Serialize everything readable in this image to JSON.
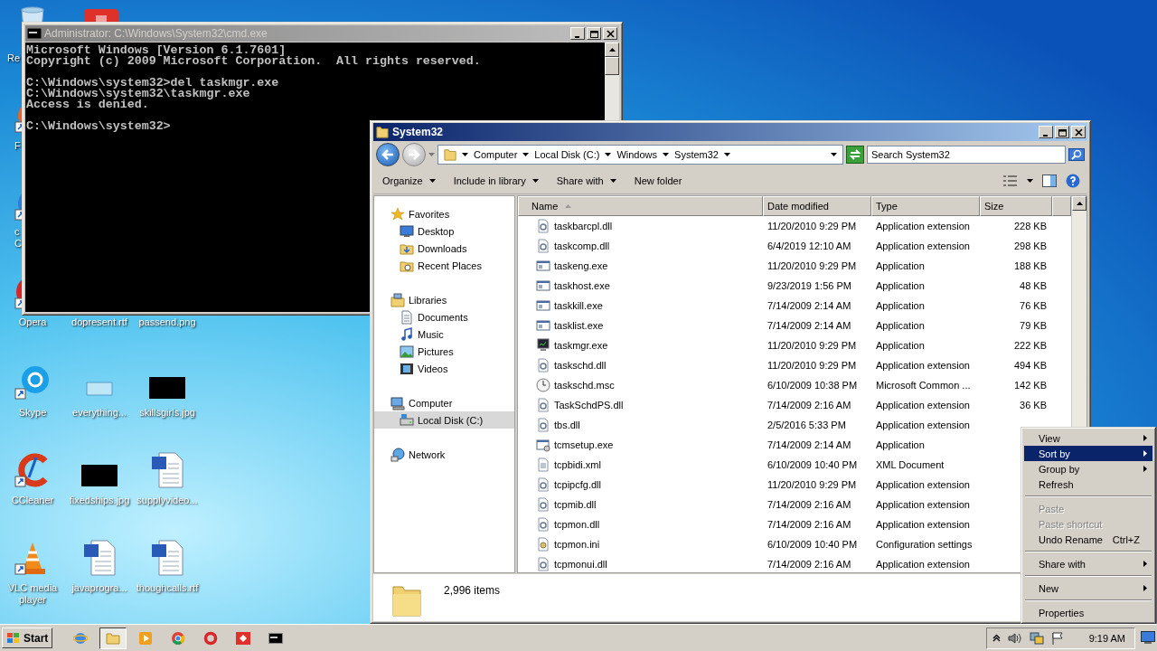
{
  "desktop": {
    "icons": [
      {
        "kind": "recycle",
        "label": "Re"
      },
      {
        "kind": "red-app"
      },
      {
        "kind": "partial-orange",
        "label": "F"
      },
      {
        "kind": "partial-blue",
        "label": "c C"
      },
      {
        "kind": "opera",
        "label": "Opera"
      },
      {
        "kind": "covered",
        "label": "dopresent.rtf"
      },
      {
        "kind": "covered",
        "label": "passend.png"
      },
      {
        "kind": "skype",
        "label": "Skype"
      },
      {
        "kind": "blank",
        "label": "everything..."
      },
      {
        "kind": "black-image",
        "label": "skillsgirls.jpg"
      },
      {
        "kind": "ccleaner",
        "label": "CCleaner"
      },
      {
        "kind": "black-image",
        "label": "fixedships.jpg"
      },
      {
        "kind": "word",
        "label": "supplyvideo..."
      },
      {
        "kind": "vlc",
        "label": "VLC media player"
      },
      {
        "kind": "word",
        "label": "javaprogra..."
      },
      {
        "kind": "word",
        "label": "thoughcalls.rtf"
      }
    ]
  },
  "cmd_window": {
    "title": "Administrator: C:\\Windows\\System32\\cmd.exe",
    "blocks": [
      [
        "Microsoft Windows [Version 6.1.7601]",
        "Copyright (c) 2009 Microsoft Corporation.  All rights reserved."
      ],
      [
        "C:\\Windows\\system32>del taskmgr.exe",
        "C:\\Windows\\system32\\taskmgr.exe",
        "Access is denied."
      ],
      [
        "C:\\Windows\\system32>"
      ]
    ]
  },
  "explorer": {
    "title": "System32",
    "breadcrumb": [
      "Computer",
      "Local Disk (C:)",
      "Windows",
      "System32"
    ],
    "search": {
      "placeholder": "Search System32"
    },
    "toolbar": [
      {
        "label": "Organize",
        "dropdown": true
      },
      {
        "label": "Include in library",
        "dropdown": true
      },
      {
        "label": "Share with",
        "dropdown": true
      },
      {
        "label": "New folder",
        "dropdown": false
      }
    ],
    "nav": [
      {
        "label": "Favorites",
        "kind": "star",
        "selected": false,
        "children": [
          {
            "label": "Desktop",
            "kind": "desktop",
            "selected": false
          },
          {
            "label": "Downloads",
            "kind": "downloads",
            "selected": false
          },
          {
            "label": "Recent Places",
            "kind": "recent",
            "selected": false
          }
        ]
      },
      {
        "label": "Libraries",
        "kind": "library",
        "selected": false,
        "children": [
          {
            "label": "Documents",
            "kind": "documents",
            "selected": false
          },
          {
            "label": "Music",
            "kind": "music",
            "selected": false
          },
          {
            "label": "Pictures",
            "kind": "pictures",
            "selected": false
          },
          {
            "label": "Videos",
            "kind": "videos",
            "selected": false
          }
        ]
      },
      {
        "label": "Computer",
        "kind": "computer",
        "selected": false,
        "children": [
          {
            "label": "Local Disk (C:)",
            "kind": "drive",
            "selected": true
          }
        ]
      },
      {
        "label": "Network",
        "kind": "network",
        "selected": false
      }
    ],
    "columns": [
      {
        "label": "Name",
        "sorted": true
      },
      {
        "label": "Date modified",
        "sorted": false
      },
      {
        "label": "Type",
        "sorted": false
      },
      {
        "label": "Size",
        "sorted": false
      }
    ],
    "rows": [
      {
        "name": "taskbarcpl.dll",
        "date": "11/20/2010 9:29 PM",
        "type": "Application extension",
        "size": "228 KB",
        "kind": "dll"
      },
      {
        "name": "taskcomp.dll",
        "date": "6/4/2019 12:10 AM",
        "type": "Application extension",
        "size": "298 KB",
        "kind": "dll"
      },
      {
        "name": "taskeng.exe",
        "date": "11/20/2010 9:29 PM",
        "type": "Application",
        "size": "188 KB",
        "kind": "exe"
      },
      {
        "name": "taskhost.exe",
        "date": "9/23/2019 1:56 PM",
        "type": "Application",
        "size": "48 KB",
        "kind": "exe"
      },
      {
        "name": "taskkill.exe",
        "date": "7/14/2009 2:14 AM",
        "type": "Application",
        "size": "76 KB",
        "kind": "exe"
      },
      {
        "name": "tasklist.exe",
        "date": "7/14/2009 2:14 AM",
        "type": "Application",
        "size": "79 KB",
        "kind": "exe"
      },
      {
        "name": "taskmgr.exe",
        "date": "11/20/2010 9:29 PM",
        "type": "Application",
        "size": "222 KB",
        "kind": "monitor"
      },
      {
        "name": "taskschd.dll",
        "date": "11/20/2010 9:29 PM",
        "type": "Application extension",
        "size": "494 KB",
        "kind": "dll"
      },
      {
        "name": "taskschd.msc",
        "date": "6/10/2009 10:38 PM",
        "type": "Microsoft Common ...",
        "size": "142 KB",
        "kind": "clock"
      },
      {
        "name": "TaskSchdPS.dll",
        "date": "7/14/2009 2:16 AM",
        "type": "Application extension",
        "size": "36 KB",
        "kind": "dll"
      },
      {
        "name": "tbs.dll",
        "date": "2/5/2016 5:33 PM",
        "type": "Application extension",
        "kind": "dll"
      },
      {
        "name": "tcmsetup.exe",
        "date": "7/14/2009 2:14 AM",
        "type": "Application",
        "kind": "setup"
      },
      {
        "name": "tcpbidi.xml",
        "date": "6/10/2009 10:40 PM",
        "type": "XML Document",
        "kind": "xml"
      },
      {
        "name": "tcpipcfg.dll",
        "date": "11/20/2010 9:29 PM",
        "type": "Application extension",
        "kind": "dll"
      },
      {
        "name": "tcpmib.dll",
        "date": "7/14/2009 2:16 AM",
        "type": "Application extension",
        "kind": "dll"
      },
      {
        "name": "tcpmon.dll",
        "date": "7/14/2009 2:16 AM",
        "type": "Application extension",
        "kind": "dll"
      },
      {
        "name": "tcpmon.ini",
        "date": "6/10/2009 10:40 PM",
        "type": "Configuration settings",
        "kind": "ini"
      },
      {
        "name": "tcpmonui.dll",
        "date": "7/14/2009 2:16 AM",
        "type": "Application extension",
        "kind": "dll"
      }
    ],
    "status": "2,996 items"
  },
  "context_menu": {
    "items": [
      {
        "kind": "submenu",
        "label": "View",
        "selected": false,
        "disabled": false
      },
      {
        "kind": "submenu",
        "label": "Sort by",
        "selected": true,
        "disabled": false
      },
      {
        "kind": "submenu",
        "label": "Group by",
        "selected": false,
        "disabled": false
      },
      {
        "kind": "command",
        "label": "Refresh",
        "selected": false,
        "disabled": false
      },
      {
        "kind": "separator"
      },
      {
        "kind": "command",
        "label": "Paste",
        "selected": false,
        "disabled": true
      },
      {
        "kind": "command",
        "label": "Paste shortcut",
        "selected": false,
        "disabled": true
      },
      {
        "kind": "command",
        "label": "Undo Rename",
        "shortcut": "Ctrl+Z",
        "selected": false,
        "disabled": false
      },
      {
        "kind": "separator"
      },
      {
        "kind": "submenu",
        "label": "Share with",
        "selected": false,
        "disabled": false
      },
      {
        "kind": "separator"
      },
      {
        "kind": "submenu",
        "label": "New",
        "selected": false,
        "disabled": false
      },
      {
        "kind": "separator"
      },
      {
        "kind": "command",
        "label": "Properties",
        "selected": false,
        "disabled": false
      }
    ]
  },
  "taskbar": {
    "start": "Start",
    "apps": [
      {
        "kind": "browser",
        "selected": false
      },
      {
        "kind": "folder",
        "selected": true
      },
      {
        "kind": "media",
        "selected": false
      },
      {
        "kind": "chrome",
        "selected": false
      },
      {
        "kind": "opera",
        "selected": false
      },
      {
        "kind": "remote",
        "selected": false
      },
      {
        "kind": "console",
        "selected": false
      }
    ],
    "clock": "9:19 AM"
  }
}
